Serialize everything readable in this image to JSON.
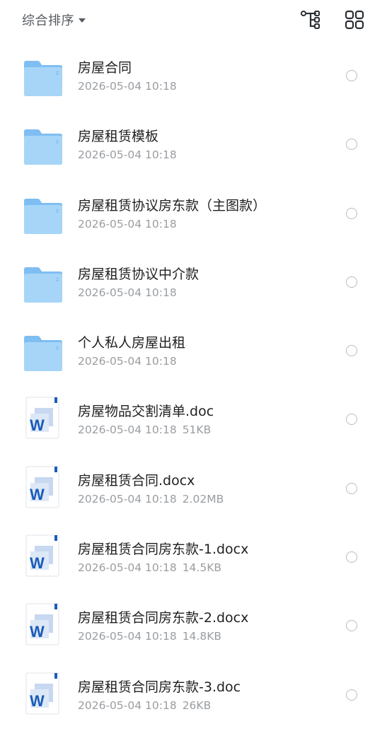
{
  "toolbar": {
    "sort_label": "综合排序",
    "tree_icon": "tree-view-icon",
    "grid_icon": "grid-view-icon"
  },
  "colors": {
    "folder_light": "#a3d3f7",
    "folder_dark": "#6fb4ee",
    "word_blue": "#1b5bb8",
    "text_primary": "#1f1f1f",
    "text_secondary": "#9a9da1"
  },
  "files": [
    {
      "type": "folder",
      "name": "房屋合同",
      "date": "2026-05-04 10:18",
      "size": ""
    },
    {
      "type": "folder",
      "name": "房屋租赁模板",
      "date": "2026-05-04 10:18",
      "size": ""
    },
    {
      "type": "folder",
      "name": "房屋租赁协议房东款（主图款）",
      "date": "2026-05-04 10:18",
      "size": ""
    },
    {
      "type": "folder",
      "name": "房屋租赁协议中介款",
      "date": "2026-05-04 10:18",
      "size": ""
    },
    {
      "type": "folder",
      "name": "个人私人房屋出租",
      "date": "2026-05-04 10:18",
      "size": ""
    },
    {
      "type": "word",
      "name": "房屋物品交割清单.doc",
      "date": "2026-05-04 10:18",
      "size": "51KB",
      "icon_letter": "W"
    },
    {
      "type": "word",
      "name": "房屋租赁合同.docx",
      "date": "2026-05-04 10:18",
      "size": "2.02MB",
      "icon_letter": "W"
    },
    {
      "type": "word",
      "name": "房屋租赁合同房东款-1.docx",
      "date": "2026-05-04 10:18",
      "size": "14.5KB",
      "icon_letter": "W"
    },
    {
      "type": "word",
      "name": "房屋租赁合同房东款-2.docx",
      "date": "2026-05-04 10:18",
      "size": "14.8KB",
      "icon_letter": "W"
    },
    {
      "type": "word",
      "name": "房屋租赁合同房东款-3.doc",
      "date": "2026-05-04 10:18",
      "size": "26KB",
      "icon_letter": "W"
    }
  ]
}
